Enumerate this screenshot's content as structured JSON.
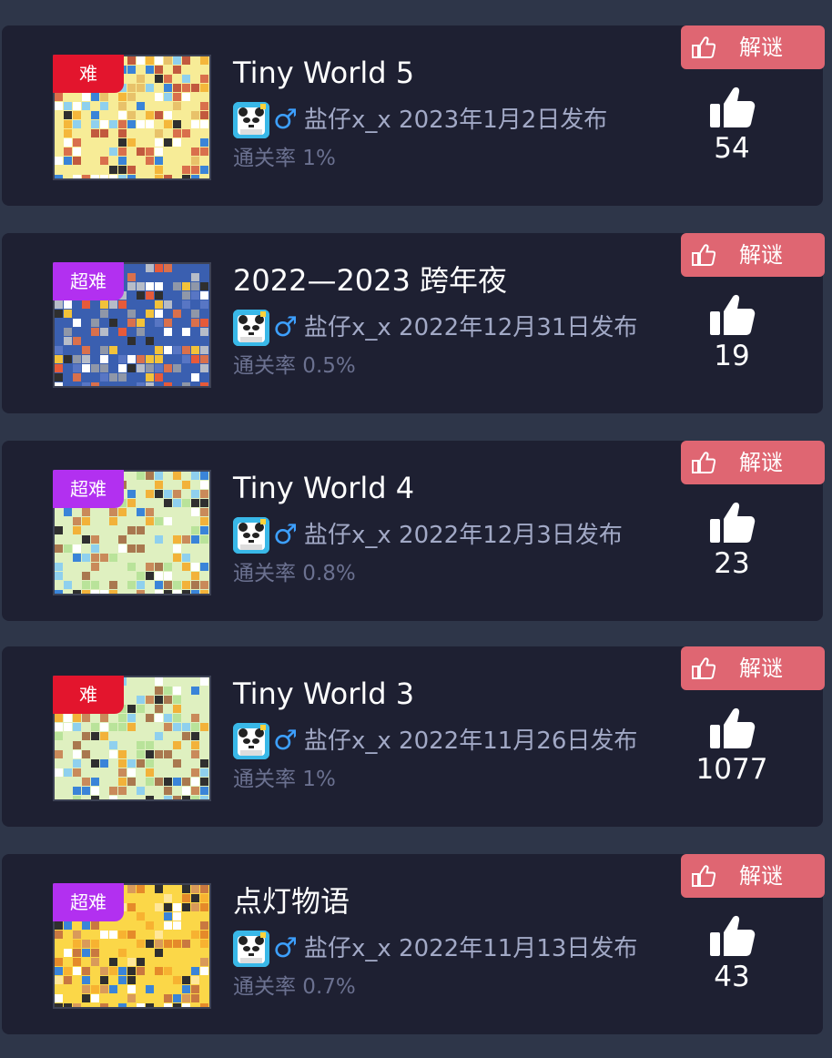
{
  "levels": [
    {
      "title": "Tiny World 5",
      "difficulty": "难",
      "author": "盐仔x_x",
      "published": "2023年1月2日发布",
      "pass_rate": "通关率 1%",
      "tag": "解谜",
      "likes": "54",
      "thumb_theme": "yellow",
      "difficulty_color": "#e3152d"
    },
    {
      "title": "2022—2023 跨年夜",
      "difficulty": "超难",
      "author": "盐仔x_x",
      "published": "2022年12月31日发布",
      "pass_rate": "通关率 0.5%",
      "tag": "解谜",
      "likes": "19",
      "thumb_theme": "blue",
      "difficulty_color": "#b230f0"
    },
    {
      "title": "Tiny World 4",
      "difficulty": "超难",
      "author": "盐仔x_x",
      "published": "2022年12月3日发布",
      "pass_rate": "通关率 0.8%",
      "tag": "解谜",
      "likes": "23",
      "thumb_theme": "green",
      "difficulty_color": "#b230f0"
    },
    {
      "title": "Tiny World 3",
      "difficulty": "难",
      "author": "盐仔x_x",
      "published": "2022年11月26日发布",
      "pass_rate": "通关率 1%",
      "tag": "解谜",
      "likes": "1077",
      "thumb_theme": "green",
      "difficulty_color": "#e3152d"
    },
    {
      "title": "点灯物语",
      "difficulty": "超难",
      "author": "盐仔x_x",
      "published": "2022年11月13日发布",
      "pass_rate": "通关率 0.7%",
      "tag": "解谜",
      "likes": "43",
      "thumb_theme": "orange",
      "difficulty_color": "#b230f0"
    }
  ],
  "icons": {
    "gender": "male-symbol-icon",
    "tag": "thumbs-up-outline-icon",
    "likes": "thumbs-up-icon",
    "avatar": "panda-avatar-icon"
  },
  "glyphs": {
    "male": "♂"
  },
  "colors": {
    "background": "#2e3649",
    "card": "#1e2032",
    "tag": "#df6672",
    "hard": "#e3152d",
    "super_hard": "#b230f0",
    "male": "#3da0ff",
    "byline": "#a2a9c6",
    "rate": "#6b7190"
  }
}
